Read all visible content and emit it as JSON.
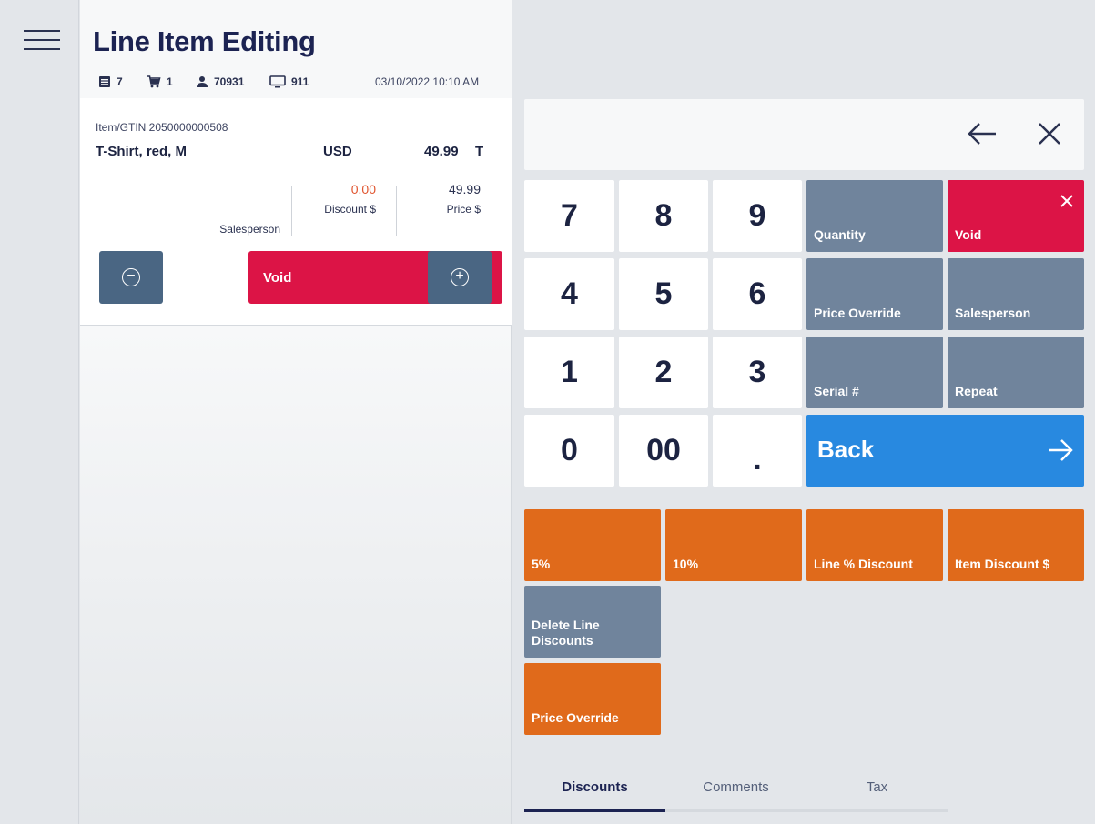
{
  "header": {
    "title": "Line Item Editing",
    "receipt_count": "7",
    "cart_count": "1",
    "user_id": "70931",
    "terminal_id": "911",
    "datetime": "03/10/2022 10:10 AM"
  },
  "item": {
    "gtin_label": "Item/GTIN 2050000000508",
    "name": "T-Shirt, red, M",
    "currency": "USD",
    "price": "49.99",
    "tax_flag": "T",
    "fields": [
      {
        "label": "Salesperson",
        "value": ""
      },
      {
        "label": "Discount $",
        "value": "0.00"
      },
      {
        "label": "Price $",
        "value": "49.99"
      }
    ],
    "void_label": "Void"
  },
  "keypad": {
    "keys": [
      "7",
      "8",
      "9",
      "4",
      "5",
      "6",
      "1",
      "2",
      "3",
      "0",
      "00",
      "."
    ]
  },
  "functions": {
    "quantity": "Quantity",
    "void": "Void",
    "price_override": "Price Override",
    "salesperson": "Salesperson",
    "serial": "Serial #",
    "repeat": "Repeat",
    "back": "Back"
  },
  "discounts": {
    "pct5": "5%",
    "pct10": "10%",
    "line_pct": "Line % Discount",
    "item_amount": "Item Discount $",
    "delete_line_1": "Delete Line",
    "delete_line_2": "Discounts",
    "price_override": "Price Override"
  },
  "tabs": [
    "Discounts",
    "Comments",
    "Tax"
  ],
  "active_tab": "Discounts",
  "colors": {
    "void_red": "#dc1446",
    "discount_orange": "#e06a1b",
    "function_slate": "#70849c",
    "back_blue": "#2889e0",
    "item_button_blue": "#4a6683",
    "discount_value_red": "#e0542e"
  }
}
